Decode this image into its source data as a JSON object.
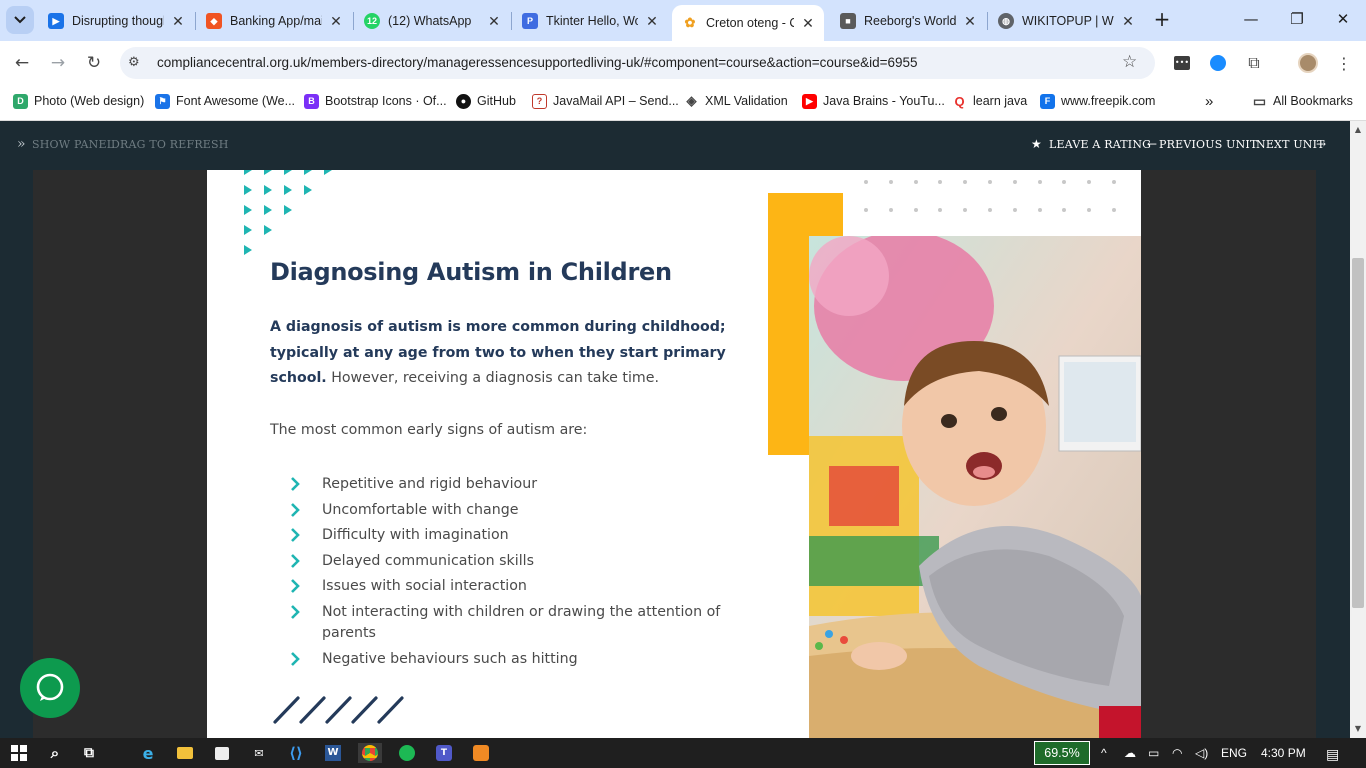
{
  "browser": {
    "tabs": [
      {
        "title": "Disrupting thoughts",
        "favicon": "video-icon",
        "color": "#1a73e8"
      },
      {
        "title": "Banking App/main",
        "favicon": "figma-like-icon",
        "color": "#f05423"
      },
      {
        "title": "(12) WhatsApp",
        "favicon": "whatsapp-icon",
        "color": "#25d366",
        "badge": "12"
      },
      {
        "title": "Tkinter Hello, World",
        "favicon": "p-icon",
        "color": "#3f6ce1",
        "letter": "P"
      },
      {
        "title": "Creton oteng - Comp",
        "favicon": "site-icon",
        "color": "#f0a020",
        "active": true
      },
      {
        "title": "Reeborg's World",
        "favicon": "robot-icon",
        "color": "#5a5a5a"
      },
      {
        "title": "WIKITOPUP | We",
        "favicon": "globe-icon",
        "color": "#5f6368"
      }
    ],
    "url": "compliancecentral.org.uk/members-directory/manageressencesupportedliving-uk/#component=course&action=course&id=6955",
    "bookmarks": [
      {
        "label": "Photo (Web design)",
        "color": "#2fa86b",
        "letter": "D"
      },
      {
        "label": "Font Awesome (We...",
        "color": "#1a73e8",
        "letter": ""
      },
      {
        "label": "Bootstrap Icons · Of...",
        "color": "#7b2ff7",
        "letter": "B"
      },
      {
        "label": "GitHub",
        "color": "#111111",
        "letter": ""
      },
      {
        "label": "JavaMail API – Send...",
        "color": "#c0392b",
        "letter": ""
      },
      {
        "label": "XML Validation",
        "color": "#444444",
        "letter": ""
      },
      {
        "label": "Java Brains - YouTu...",
        "color": "#ff0000",
        "letter": ""
      },
      {
        "label": "learn java",
        "color": "#e8322e",
        "letter": "Q"
      },
      {
        "label": "www.freepik.com",
        "color": "#1273eb",
        "letter": "F"
      }
    ],
    "all_bookmarks": "All Bookmarks",
    "more": "»"
  },
  "course_bar": {
    "show_panel": "SHOW PANEL",
    "drag_refresh": "DRAG TO REFRESH",
    "leave_rating": "LEAVE A RATING",
    "previous_unit": "PREVIOUS UNIT",
    "next_unit": "NEXT UNIT"
  },
  "slide": {
    "title": "Diagnosing Autism in Children",
    "intro_bold": "A diagnosis of autism is more common during childhood; typically at any age from two to when they start primary school.",
    "intro_rest": " However, receiving a diagnosis can take time.",
    "signs_lead": "The most common early signs of autism are:",
    "signs": [
      "Repetitive and rigid behaviour",
      "Uncomfortable with change",
      "Difficulty with imagination",
      "Delayed communication skills",
      "Issues with social interaction",
      "Not interacting with children or drawing the attention of parents",
      "Negative behaviours such as hitting"
    ],
    "accent_teal": "#1fb5b2",
    "accent_yellow": "#fdb515",
    "heading_color": "#243a5a"
  },
  "taskbar": {
    "battery": "69.5%",
    "language": "ENG",
    "time": "4:30 PM"
  }
}
